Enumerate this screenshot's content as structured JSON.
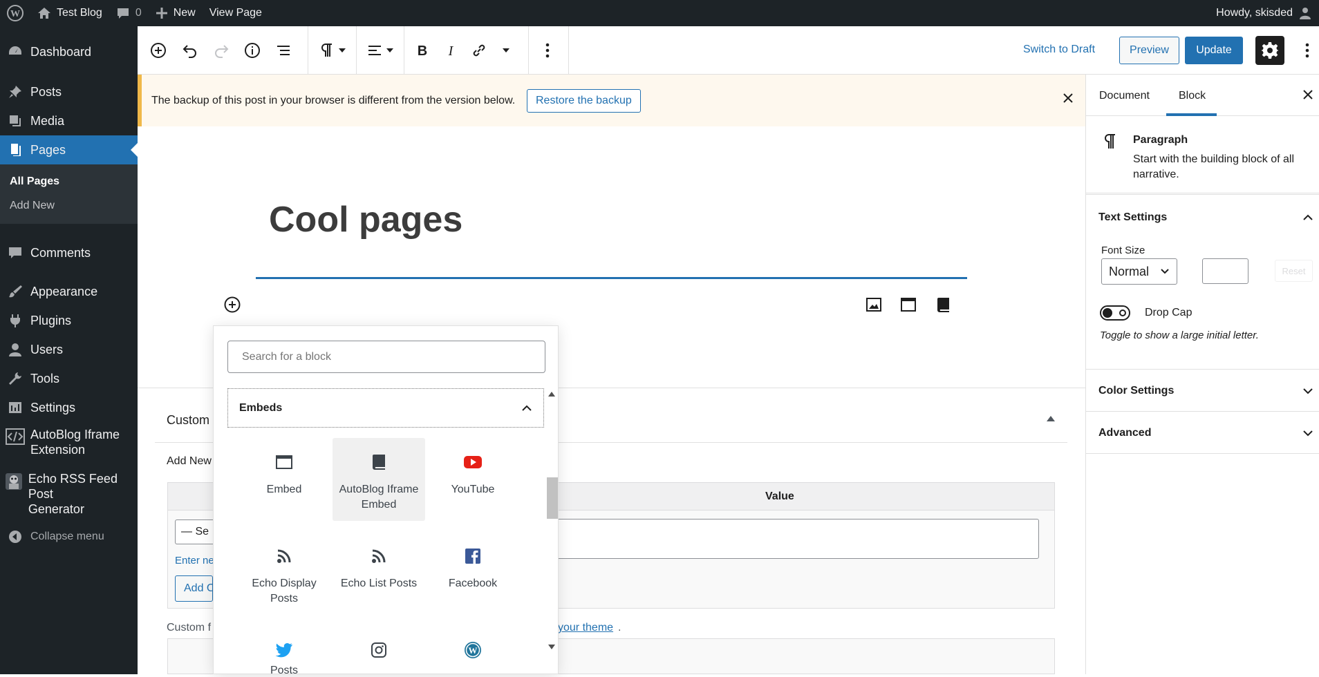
{
  "admin_bar": {
    "site_name": "Test Blog",
    "comments_count": "0",
    "new_label": "New",
    "view_label": "View Page",
    "greeting": "Howdy, skisded"
  },
  "sidebar": {
    "dashboard": "Dashboard",
    "posts": "Posts",
    "media": "Media",
    "pages": "Pages",
    "all_pages": "All Pages",
    "add_new": "Add New",
    "comments": "Comments",
    "appearance": "Appearance",
    "plugins": "Plugins",
    "users": "Users",
    "tools": "Tools",
    "settings": "Settings",
    "autoblog_1": "AutoBlog Iframe",
    "autoblog_2": "Extension",
    "echo_1": "Echo RSS Feed Post",
    "echo_2": "Generator",
    "collapse": "Collapse menu"
  },
  "header": {
    "switch_to_draft": "Switch to Draft",
    "preview": "Preview",
    "update": "Update"
  },
  "notice": {
    "message": "The backup of this post in your browser is different from the version below.",
    "restore": "Restore the backup"
  },
  "editor": {
    "title": "Cool pages"
  },
  "metabox": {
    "title": "Custom",
    "add_new": "Add New",
    "value_header": "Value",
    "select_value": "— Se",
    "enter_new": "Enter ne",
    "add_button": "Add C",
    "footer_text": "Custom f",
    "footer_link": "your theme",
    "footer_tail": "."
  },
  "inserter": {
    "search_placeholder": "Search for a block",
    "panel_title": "Embeds",
    "items": [
      {
        "label": "Embed",
        "icon": "embed-icon"
      },
      {
        "label": "AutoBlog Iframe Embed",
        "icon": "book-icon"
      },
      {
        "label": "YouTube",
        "icon": "youtube-icon"
      },
      {
        "label": "Echo Display Posts",
        "icon": "rss-icon"
      },
      {
        "label": "Echo List Posts",
        "icon": "rss-icon"
      },
      {
        "label": "Facebook",
        "icon": "facebook-icon"
      },
      {
        "label": "Posts",
        "icon": "twitter-icon"
      },
      {
        "label": "",
        "icon": "instagram-icon"
      },
      {
        "label": "",
        "icon": "wordpress-icon"
      }
    ]
  },
  "settings_panel": {
    "tab_document": "Document",
    "tab_block": "Block",
    "block_name": "Paragraph",
    "block_desc": "Start with the building block of all narrative.",
    "text_settings": "Text Settings",
    "font_size_label": "Font Size",
    "font_size_value": "Normal",
    "reset": "Reset",
    "drop_cap": "Drop Cap",
    "drop_cap_help": "Toggle to show a large initial letter.",
    "color_settings": "Color Settings",
    "advanced": "Advanced"
  },
  "colors": {
    "admin_dark": "#1d2327",
    "accent": "#2271b1",
    "notice_bg": "#fef8ee"
  }
}
